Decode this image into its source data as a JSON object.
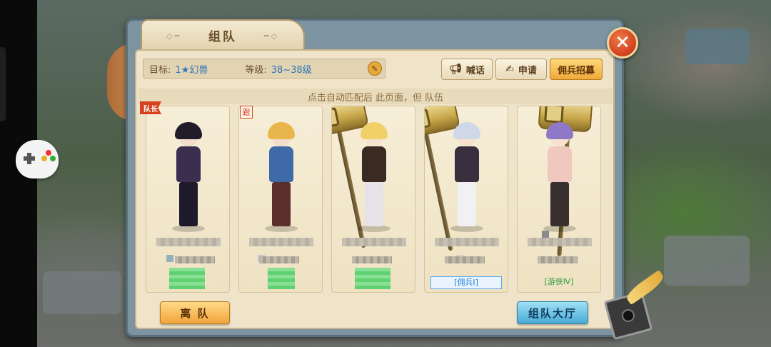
{
  "panel": {
    "title": "组队",
    "close_label": "✕"
  },
  "info": {
    "target_label": "目标:",
    "target_value": "1★幻兽",
    "level_label": "等级:",
    "level_value": "38~38级"
  },
  "top_buttons": {
    "shout": "喊话",
    "apply": "申请",
    "recruit": "佣兵招募"
  },
  "notice": "点击自动匹配后 此页面，但 队伍",
  "badges": {
    "leader": "队长",
    "follow": "跟"
  },
  "members": [
    {
      "tag": ""
    },
    {
      "tag": ""
    },
    {
      "tag": ""
    },
    {
      "tag": "[佣兵Ⅰ]"
    },
    {
      "tag": "[游侠Ⅳ]"
    }
  ],
  "bottom_buttons": {
    "leave": "离 队",
    "hall": "组队大厅"
  },
  "colors": {
    "accent_orange": "#f0a93b",
    "accent_blue": "#4aaad6",
    "close_red": "#cf3f1c",
    "parchment": "#efe4c9"
  },
  "icons": [
    "gamepad-icon",
    "megaphone-icon",
    "apply-icon",
    "close-icon",
    "edit-icon",
    "quill-icon"
  ]
}
